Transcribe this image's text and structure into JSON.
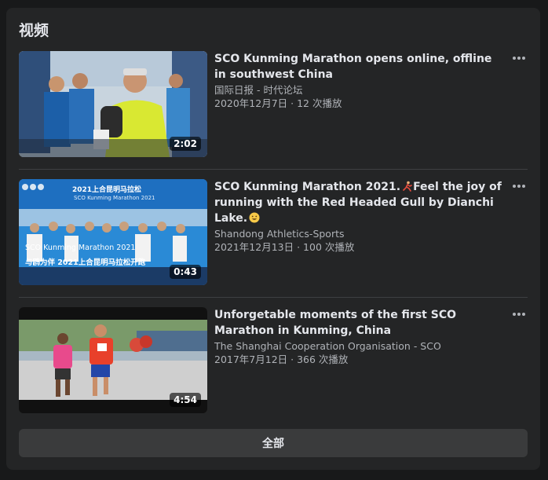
{
  "section": {
    "title": "视频"
  },
  "videos": [
    {
      "title": "SCO Kunming Marathon opens online, offline in southwest China",
      "title_suffix": "",
      "channel": "国际日报 - 时代论坛",
      "meta": "2020年12月7日 · 12 次播放",
      "duration": "2:02",
      "thumb_colors": {
        "sky": "#b8c9d9",
        "crowd": "#1c5fa8",
        "jacket": "#d9e832"
      }
    },
    {
      "title": "SCO Kunming Marathon 2021.",
      "title_suffix": "Feel the joy of running with the Red Headed Gull by Dianchi Lake.",
      "channel": "Shandong Athletics-Sports",
      "meta": "2021年12月13日 · 100 次播放",
      "duration": "0:43",
      "thumb_text": [
        "2021上合昆明马拉松",
        "SCO Kunming Marathon 2021",
        "SCO Kunming Marathon 2021",
        "与鸥为伴 2021上合昆明马拉松开跑"
      ],
      "thumb_colors": {
        "banner": "#1e6fc0",
        "crowd": "#2a8ad6"
      }
    },
    {
      "title": "Unforgetable moments of the first SCO Marathon in Kunming, China",
      "title_suffix": "",
      "channel": "The Shanghai Cooperation Organisation - SCO",
      "meta": "2017年7月12日 · 366 次播放",
      "duration": "4:54",
      "thumb_colors": {
        "road": "#cfcfcf",
        "runner1": "#e84a8c",
        "runner2": "#e8402a"
      }
    }
  ],
  "all_button": {
    "label": "全部"
  },
  "icons": {
    "more": "more-horizontal-icon",
    "runner": "runner-emoji-icon",
    "grin": "grin-emoji-icon"
  }
}
